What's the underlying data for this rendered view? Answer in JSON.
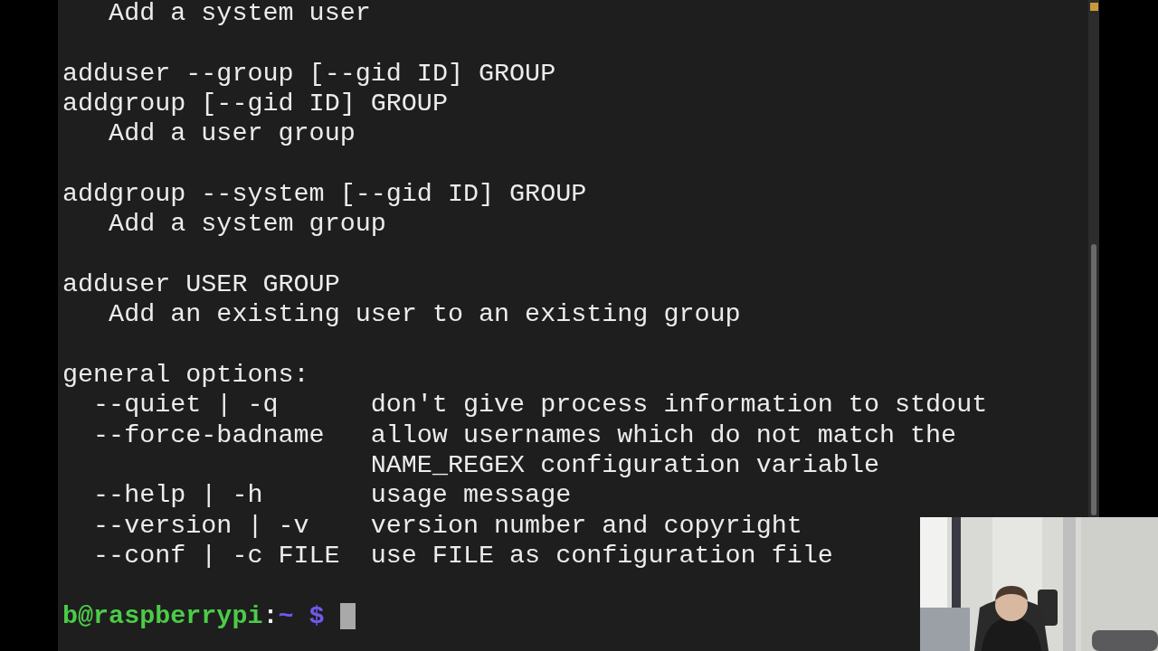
{
  "terminal": {
    "lines": [
      {
        "kind": "description",
        "text": "Add a system user"
      },
      {
        "kind": "blank"
      },
      {
        "kind": "command",
        "text": "adduser --group [--gid ID] GROUP"
      },
      {
        "kind": "command",
        "text": "addgroup [--gid ID] GROUP"
      },
      {
        "kind": "description",
        "text": "Add a user group"
      },
      {
        "kind": "blank"
      },
      {
        "kind": "command",
        "text": "addgroup --system [--gid ID] GROUP"
      },
      {
        "kind": "description",
        "text": "Add a system group"
      },
      {
        "kind": "blank"
      },
      {
        "kind": "command",
        "text": "adduser USER GROUP"
      },
      {
        "kind": "description",
        "text": "Add an existing user to an existing group"
      },
      {
        "kind": "blank"
      },
      {
        "kind": "command",
        "text": "general options:"
      },
      {
        "kind": "option",
        "option": "--quiet | -q",
        "description": "don't give process information to stdout"
      },
      {
        "kind": "option",
        "option": "--force-badname",
        "description": "allow usernames which do not match the"
      },
      {
        "kind": "continuation",
        "description": "NAME_REGEX configuration variable"
      },
      {
        "kind": "option",
        "option": "--help | -h",
        "description": "usage message"
      },
      {
        "kind": "option",
        "option": "--version | -v",
        "description": "version number and copyright"
      },
      {
        "kind": "option",
        "option": "--conf | -c FILE",
        "description": "use FILE as configuration file"
      },
      {
        "kind": "blank"
      },
      {
        "kind": "prompt",
        "user_host": "b@raspberrypi",
        "separator": ":",
        "path": "~",
        "symbol": "$"
      }
    ]
  }
}
